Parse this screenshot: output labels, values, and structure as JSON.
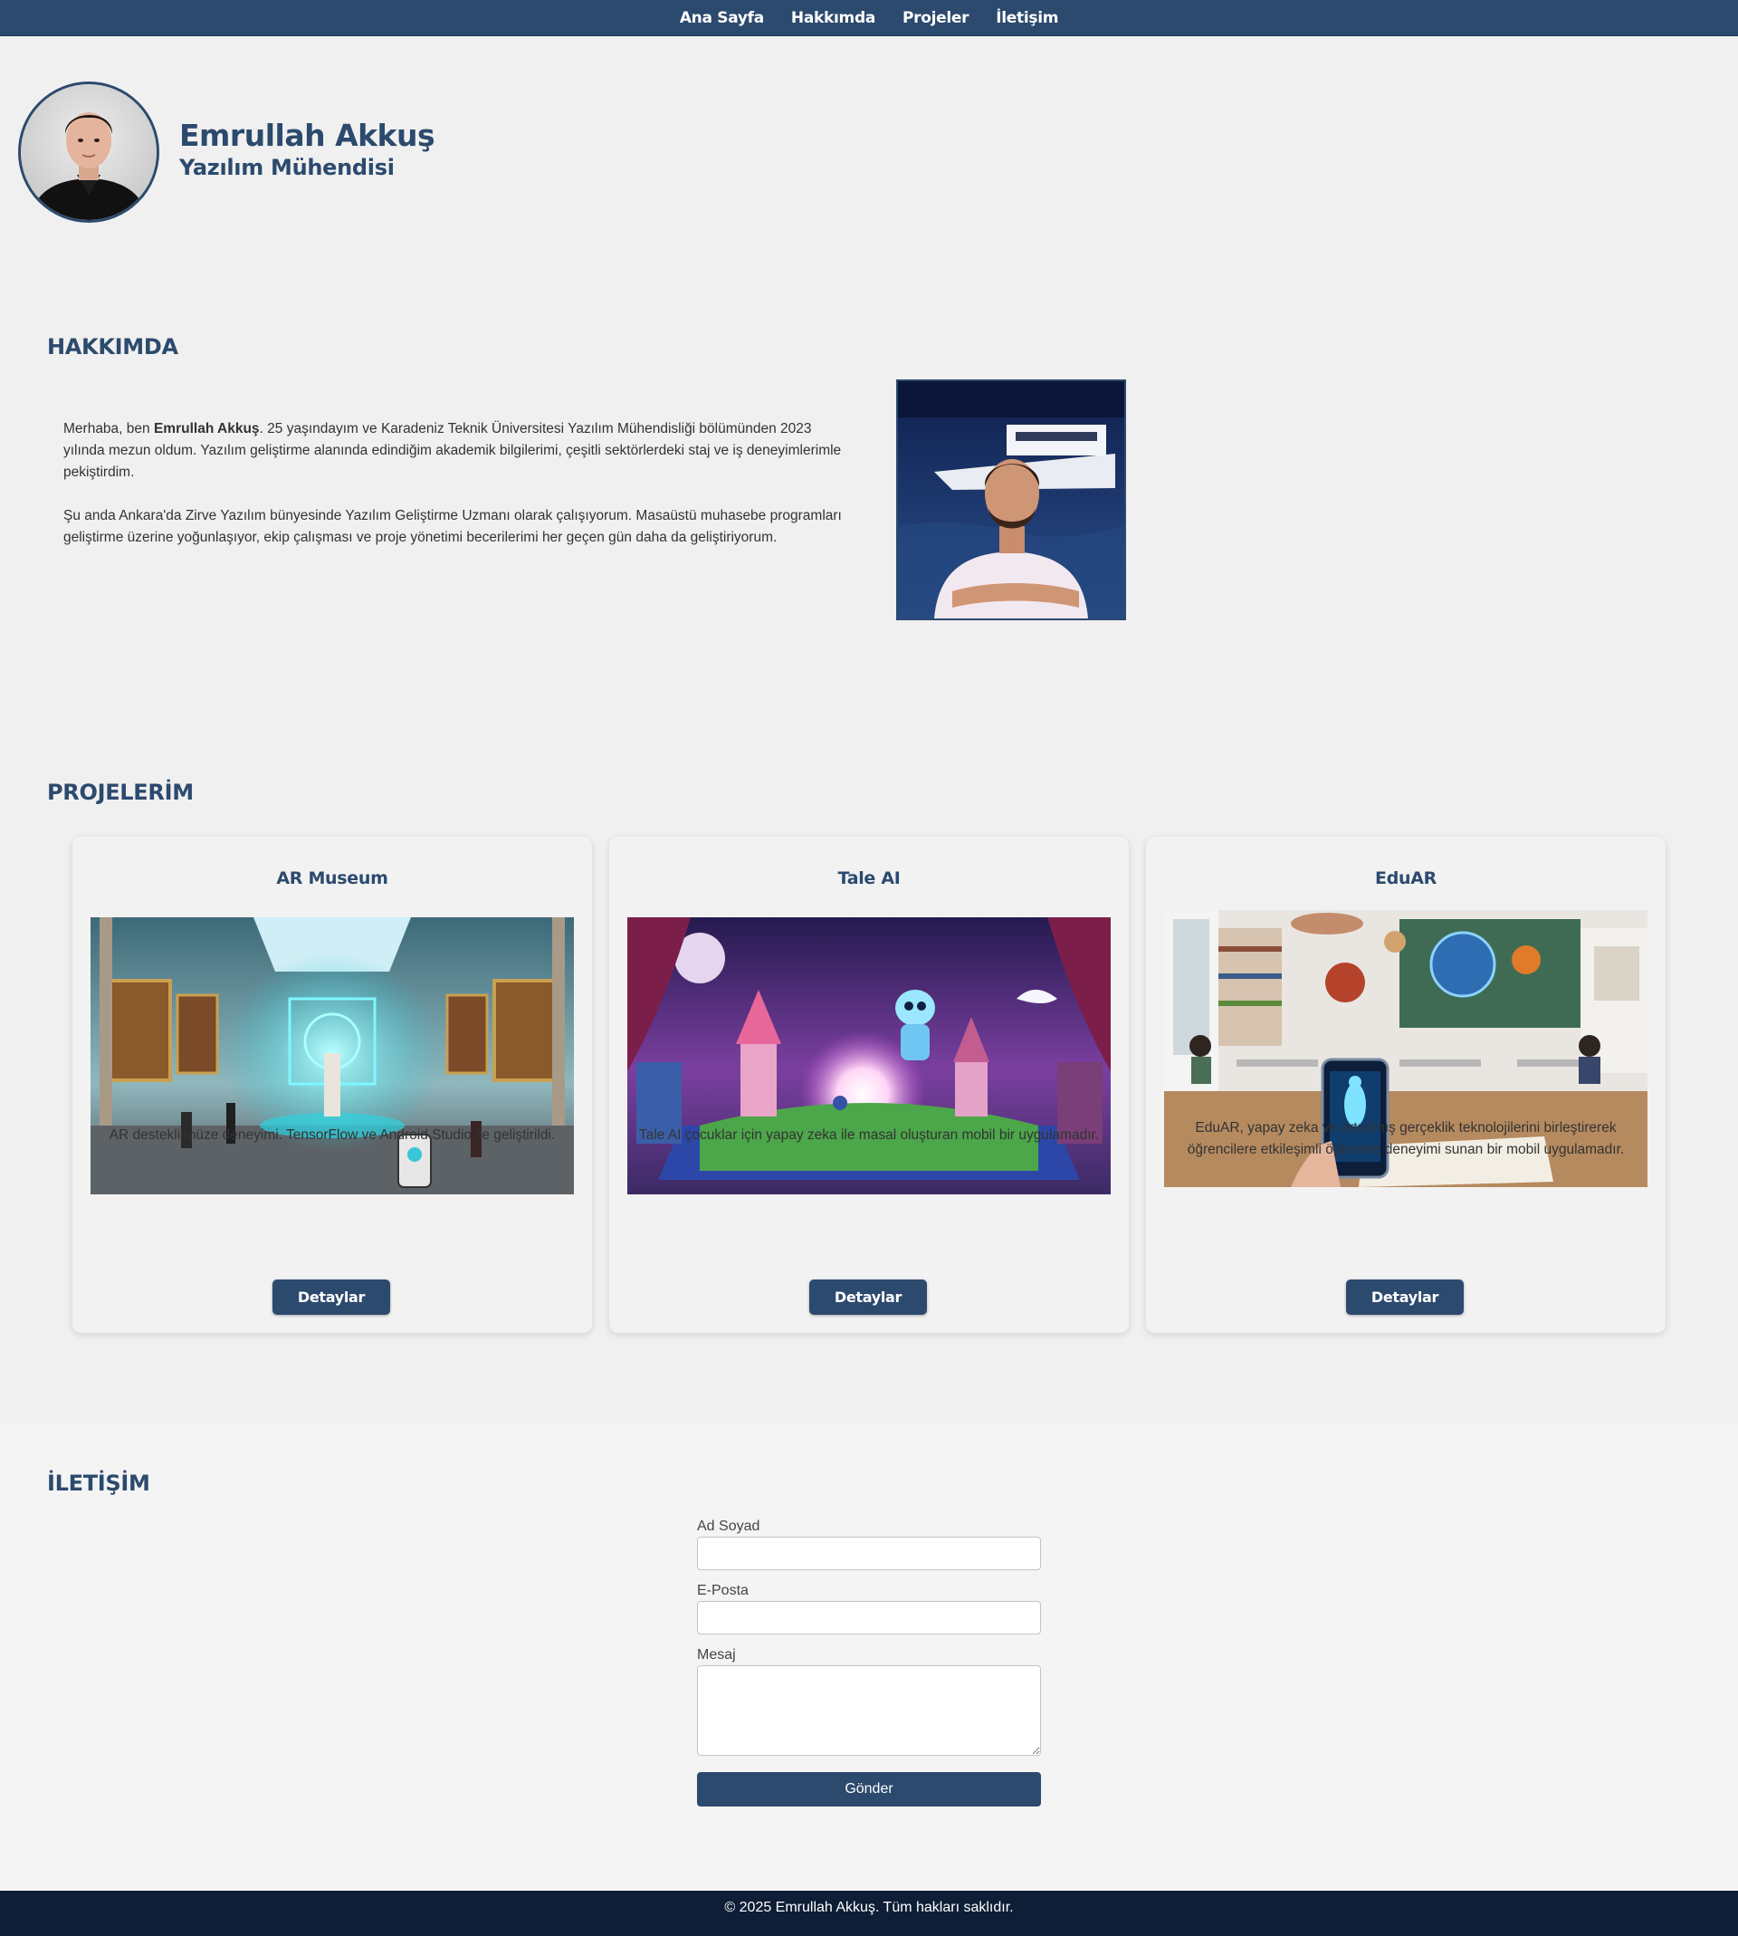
{
  "nav": {
    "items": [
      "Ana Sayfa",
      "Hakkımda",
      "Projeler",
      "İletişim"
    ]
  },
  "header": {
    "name": "Emrullah Akkuş",
    "title": "Yazılım Mühendisi"
  },
  "about": {
    "heading": "HAKKIMDA",
    "p1_prefix": "Merhaba, ben ",
    "p1_name": "Emrullah Akkuş",
    "p1_rest": ". 25 yaşındayım ve Karadeniz Teknik Üniversitesi Yazılım Mühendisliği bölümünden 2023 yılında mezun oldum. Yazılım geliştirme alanında edindiğim akademik bilgilerimi, çeşitli sektörlerdeki staj ve iş deneyimlerimle pekiştirdim.",
    "p2": "Şu anda Ankara'da Zirve Yazılım bünyesinde Yazılım Geliştirme Uzmanı olarak çalışıyorum. Masaüstü muhasebe programları geliştirme üzerine yoğunlaşıyor, ekip çalışması ve proje yönetimi becerilerimi her geçen gün daha da geliştiriyorum."
  },
  "projects": {
    "heading": "PROJELERİM",
    "items": [
      {
        "title": "AR Museum",
        "description": "AR destekli müze deneyimi. TensorFlow ve Android Studio ile geliştirildi.",
        "button": "Detaylar"
      },
      {
        "title": "Tale AI",
        "description": "Tale AI çocuklar için yapay zeka ile masal oluşturan mobil bir uygulamadır.",
        "button": "Detaylar"
      },
      {
        "title": "EduAR",
        "description": "EduAR, yapay zeka ve artırılmış gerçeklik teknolojilerini birleştirerek öğrencilere etkileşimli öğrenme deneyimi sunan bir mobil uygulamadır.",
        "button": "Detaylar"
      }
    ]
  },
  "contact": {
    "heading": "İLETİŞİM",
    "name_label": "Ad Soyad",
    "email_label": "E-Posta",
    "message_label": "Mesaj",
    "name_value": "",
    "email_value": "",
    "message_value": "",
    "submit": "Gönder"
  },
  "footer": {
    "text": "© 2025 Emrullah Akkuş. Tüm hakları saklıdır."
  },
  "colors": {
    "primary": "#2c4a6e",
    "footer": "#0e1e36",
    "background": "#f0f0f0"
  }
}
